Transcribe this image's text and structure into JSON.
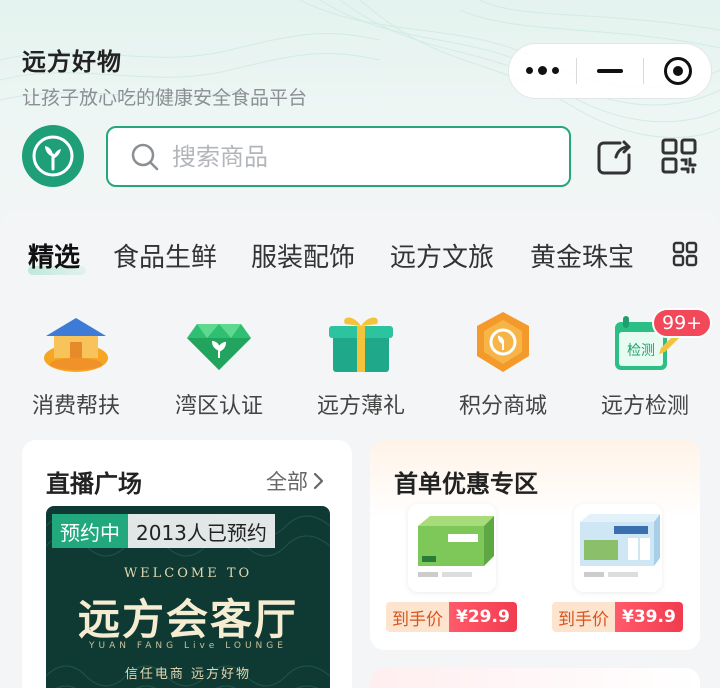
{
  "app": {
    "title": "远方好物",
    "subtitle": "让孩子放心吃的健康安全食品平台"
  },
  "capsule": {
    "more_icon": "more-dots-icon",
    "minimize_icon": "minimize-icon",
    "close_icon": "target-circle-icon"
  },
  "search": {
    "placeholder": "搜索商品"
  },
  "categories": [
    {
      "label": "精选",
      "active": true
    },
    {
      "label": "食品生鲜"
    },
    {
      "label": "服装配饰"
    },
    {
      "label": "远方文旅"
    },
    {
      "label": "黄金珠宝"
    }
  ],
  "shortcuts": [
    {
      "label": "消费帮扶",
      "icon": "house-icon"
    },
    {
      "label": "湾区认证",
      "icon": "gem-icon"
    },
    {
      "label": "远方薄礼",
      "icon": "gift-icon"
    },
    {
      "label": "积分商城",
      "icon": "points-hexagon-icon"
    },
    {
      "label": "远方检测",
      "icon": "inspection-icon",
      "icon_text": "检测",
      "badge": "99+"
    }
  ],
  "live": {
    "title": "直播广场",
    "all_label": "全部",
    "status": "预约中",
    "reserved": "2013人已预约",
    "banner_welcome": "WELCOME TO",
    "banner_title": "远方会客厅",
    "banner_sub": "YUAN FANG Live LOUNGE",
    "banner_slogan": "信任电商 远方好物"
  },
  "first_order": {
    "title": "首单优惠专区",
    "products": [
      {
        "price_label": "到手价",
        "price": "¥29.9"
      },
      {
        "price_label": "到手价",
        "price": "¥39.9"
      }
    ]
  },
  "colors": {
    "brand_green": "#22a87d",
    "price_red": "#f23b4f",
    "badge_red": "#f2485a"
  }
}
